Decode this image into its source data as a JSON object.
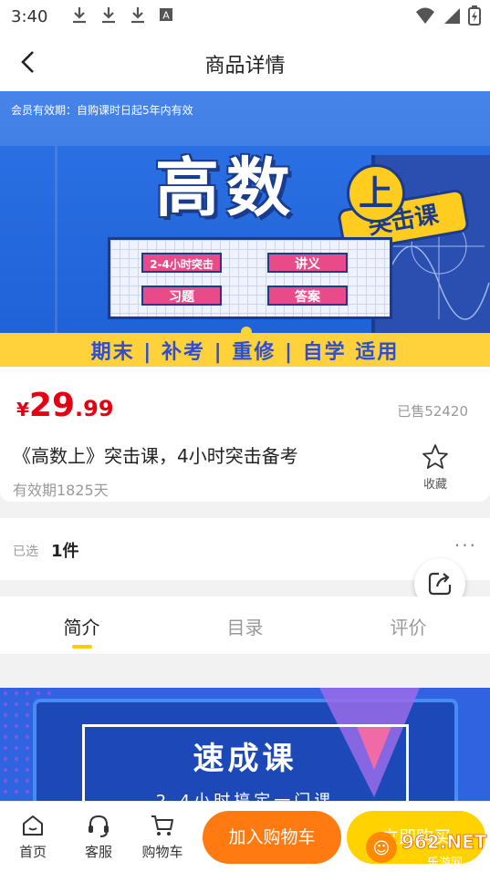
{
  "status_bar": {
    "time": "3:40",
    "icons": [
      "download-icon",
      "download-icon",
      "download-icon",
      "app-a-icon",
      "wifi-icon",
      "signal-icon",
      "battery-icon"
    ]
  },
  "header": {
    "title": "商品详情"
  },
  "banner": {
    "validity_note": "会员有效期：自购课时日起5年内有效",
    "tag": "突击课",
    "title": "高数",
    "title_badge": "上",
    "pills": [
      "2-4小时突击",
      "讲义",
      "习题",
      "答案"
    ],
    "strip": "期末 | 补考 | 重修 | 自学 适用"
  },
  "product": {
    "currency": "¥",
    "price_int": "29",
    "price_dec": ".99",
    "sold": "已售52420",
    "title": "《高数上》突击课，4小时突击备考",
    "validity": "有效期1825天",
    "favorite_label": "收藏"
  },
  "selection": {
    "label": "已选",
    "value": "1件",
    "more": "···"
  },
  "tabs": [
    {
      "label": "简介",
      "active": true
    },
    {
      "label": "目录",
      "active": false
    },
    {
      "label": "评价",
      "active": false
    }
  ],
  "detail": {
    "title": "速成课",
    "subtitle": "2-4小时搞定一门课"
  },
  "bottom_nav": {
    "home": "首页",
    "service": "客服",
    "cart": "购物车",
    "add_to_cart": "加入购物车",
    "buy_now": "立即购买"
  },
  "watermark": {
    "text": "962.NET",
    "sub": "乐游网"
  },
  "colors": {
    "price": "#e60012",
    "accent_orange": "#ff7a10",
    "accent_yellow": "#ffd200",
    "tab_indicator": "#ffcc00",
    "banner_blue": "#2d73e6"
  }
}
